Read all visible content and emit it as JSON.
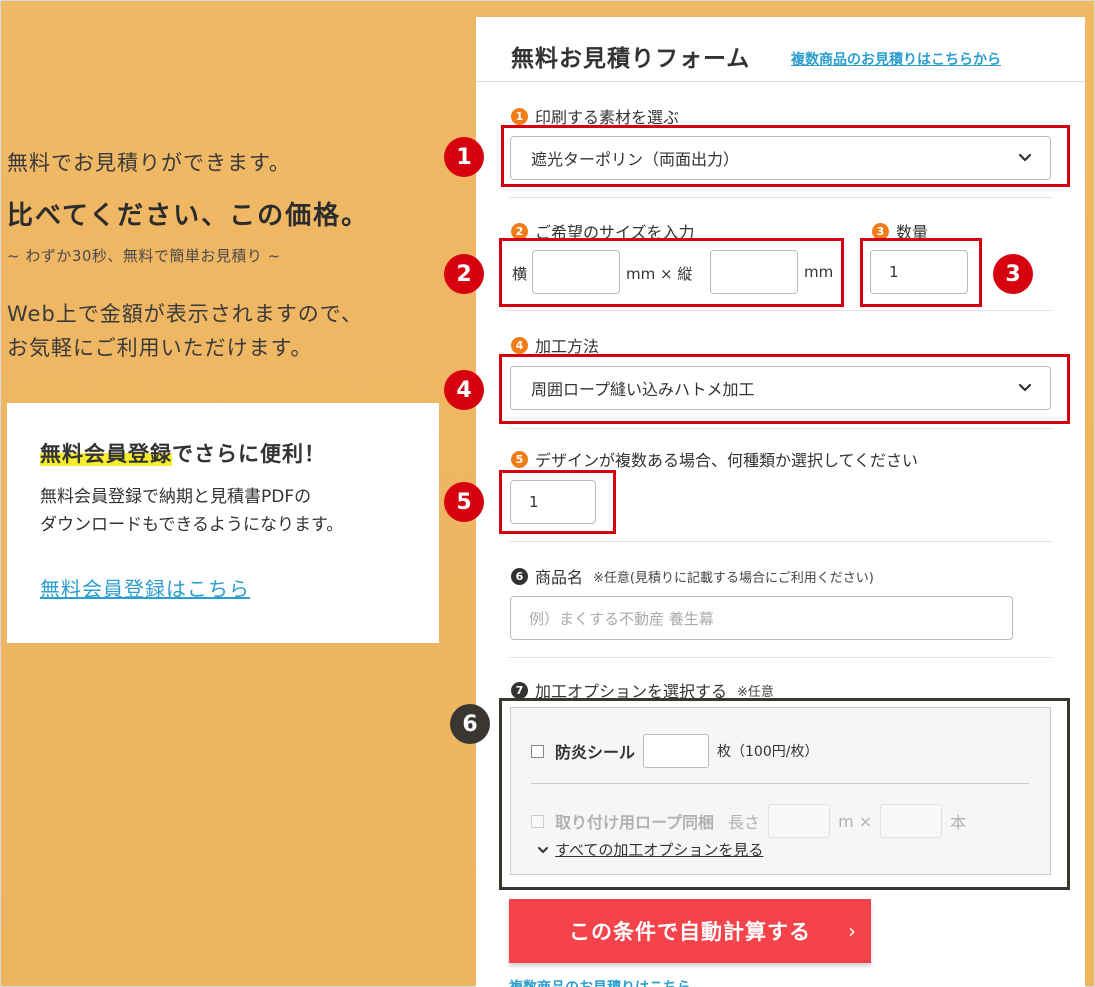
{
  "left": {
    "lead1": "無料でお見積りができます。",
    "lead2": "比べてください、この価格。",
    "lead3": "~ わずか30秒、無料で簡単お見積り ~",
    "lead4_line1": "Web上で金額が表示されますので、",
    "lead4_line2": "お気軽にご利用いただけます。",
    "member": {
      "title_highlight": "無料会員登録",
      "title_rest": "でさらに便利！",
      "text_line1": "無料会員登録で納期と見積書PDFの",
      "text_line2": "ダウンロードもできるようになります。",
      "link": "無料会員登録はこちら"
    }
  },
  "form": {
    "title": "無料お見積りフォーム",
    "title_link": "複数商品のお見積りはこちらから",
    "step1": {
      "num": "1",
      "label": "印刷する素材を選ぶ",
      "value": "遮光ターポリン（両面出力）"
    },
    "step2": {
      "num": "2",
      "label": "ご希望のサイズを入力",
      "width_label": "横",
      "mid_label": "mm × 縦",
      "unit": "mm",
      "width_value": "",
      "height_value": ""
    },
    "step3": {
      "num": "3",
      "label": "数量",
      "value": "1"
    },
    "step4": {
      "num": "4",
      "label": "加工方法",
      "value": "周囲ロープ縫い込みハトメ加工"
    },
    "step5": {
      "num": "5",
      "label": "デザインが複数ある場合、何種類か選択してください",
      "value": "1"
    },
    "step6": {
      "num": "6",
      "label": "商品名",
      "note": "※任意(見積りに記載する場合にご利用ください)",
      "placeholder": "例）まくする不動産 養生幕"
    },
    "step7": {
      "num": "7",
      "label": "加工オプションを選択する",
      "note": "※任意"
    },
    "options": {
      "opt1_label": "防炎シール",
      "opt1_unit": "枚（100円/枚）",
      "opt2_label": "取り付け用ロープ同梱",
      "opt2_length": "長さ",
      "opt2_mid": "m ×",
      "opt2_unit": "本",
      "see_all": "すべての加工オプションを見る"
    },
    "calc_button": "この条件で自動計算する",
    "bottom_link": "複数商品のお見積りはこちら"
  },
  "annotations": {
    "a1": "1",
    "a2": "2",
    "a3": "3",
    "a4": "4",
    "a5": "5",
    "a6": "6"
  },
  "colors": {
    "accent_red": "#d7000f",
    "button_red": "#f4434a",
    "link_blue": "#2b9ed0",
    "step_orange": "#f07d1a",
    "background_orange": "#efb865"
  }
}
